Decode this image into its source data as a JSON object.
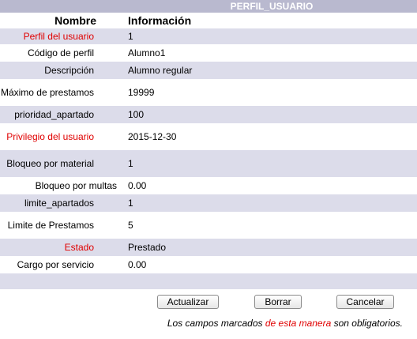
{
  "header": {
    "title": "PERFIL_USUARIO"
  },
  "columns": {
    "name": "Nombre",
    "info": "Información"
  },
  "rows": [
    {
      "label": "Perfil del usuario",
      "value": "1",
      "required": true
    },
    {
      "label": "Código de perfil",
      "value": "Alumno1",
      "required": false
    },
    {
      "label": "Descripción",
      "value": "Alumno regular",
      "required": false
    },
    {
      "label": "Máximo de prestamos",
      "value": "19999",
      "required": false
    },
    {
      "label": "prioridad_apartado",
      "value": "100",
      "required": false
    },
    {
      "label": "Privilegio del usuario",
      "value": "2015-12-30",
      "required": true
    },
    {
      "label": "Bloqueo por material",
      "value": "1",
      "required": false
    },
    {
      "label": "Bloqueo por multas",
      "value": "0.00",
      "required": false
    },
    {
      "label": "limite_apartados",
      "value": "1",
      "required": false
    },
    {
      "label": "Limite de Prestamos",
      "value": "5",
      "required": false
    },
    {
      "label": "Estado",
      "value": "Prestado",
      "required": true
    },
    {
      "label": "Cargo por servicio",
      "value": "0.00",
      "required": false
    }
  ],
  "buttons": {
    "update": "Actualizar",
    "delete": "Borrar",
    "cancel": "Cancelar"
  },
  "footer": {
    "note_before": "Los campos marcados ",
    "note_highlight": "de esta manera",
    "note_after": " son obligatorios."
  },
  "colors": {
    "accent": "#b9b9cf",
    "row_shade": "#dcdcea",
    "required": "#e00000"
  }
}
